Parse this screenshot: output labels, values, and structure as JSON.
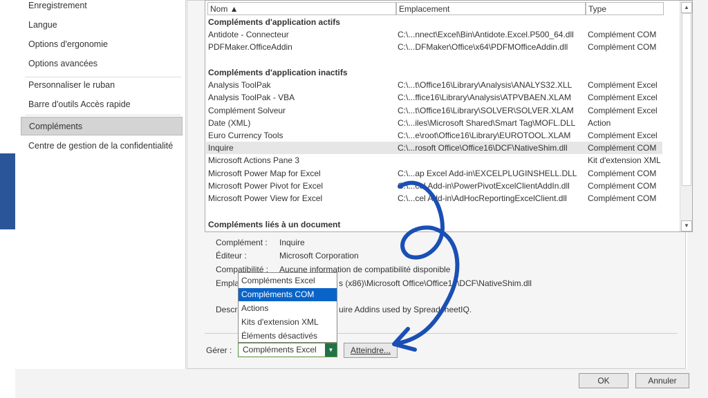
{
  "nav": {
    "items": [
      {
        "label": "Enregistrement"
      },
      {
        "label": "Langue"
      },
      {
        "label": "Options d'ergonomie"
      },
      {
        "label": "Options avancées"
      },
      {
        "label": "Personnaliser le ruban"
      },
      {
        "label": "Barre d'outils Accès rapide"
      },
      {
        "label": "Compléments"
      },
      {
        "label": "Centre de gestion de la confidentialité"
      }
    ]
  },
  "list": {
    "headers": {
      "name": "Nom ▲",
      "location": "Emplacement",
      "type": "Type"
    },
    "groups": {
      "active": "Compléments d'application actifs",
      "inactive": "Compléments d'application inactifs",
      "document": "Compléments liés à un document"
    },
    "active_rows": [
      {
        "name": "Antidote - Connecteur",
        "location": "C:\\...nnect\\Excel\\Bin\\Antidote.Excel.P500_64.dll",
        "type": "Complément COM"
      },
      {
        "name": "PDFMaker.OfficeAddin",
        "location": "C:\\...DFMaker\\Office\\x64\\PDFMOfficeAddin.dll",
        "type": "Complément COM"
      }
    ],
    "inactive_rows": [
      {
        "name": "Analysis ToolPak",
        "location": "C:\\...t\\Office16\\Library\\Analysis\\ANALYS32.XLL",
        "type": "Complément Excel"
      },
      {
        "name": "Analysis ToolPak - VBA",
        "location": "C:\\...ffice16\\Library\\Analysis\\ATPVBAEN.XLAM",
        "type": "Complément Excel"
      },
      {
        "name": "Complément Solveur",
        "location": "C:\\...t\\Office16\\Library\\SOLVER\\SOLVER.XLAM",
        "type": "Complément Excel"
      },
      {
        "name": "Date (XML)",
        "location": "C:\\...iles\\Microsoft Shared\\Smart Tag\\MOFL.DLL",
        "type": "Action"
      },
      {
        "name": "Euro Currency Tools",
        "location": "C:\\...e\\root\\Office16\\Library\\EUROTOOL.XLAM",
        "type": "Complément Excel"
      },
      {
        "name": "Inquire",
        "location": "C:\\...rosoft Office\\Office16\\DCF\\NativeShim.dll",
        "type": "Complément COM"
      },
      {
        "name": "Microsoft Actions Pane 3",
        "location": "",
        "type": "Kit d'extension XML"
      },
      {
        "name": "Microsoft Power Map for Excel",
        "location": "C:\\...ap Excel Add-in\\EXCELPLUGINSHELL.DLL",
        "type": "Complément COM"
      },
      {
        "name": "Microsoft Power Pivot for Excel",
        "location": "C:\\...cel Add-in\\PowerPivotExcelClientAddIn.dll",
        "type": "Complément COM"
      },
      {
        "name": "Microsoft Power View for Excel",
        "location": "C:\\...cel Add-in\\AdHocReportingExcelClient.dll",
        "type": "Complément COM"
      }
    ]
  },
  "details": {
    "addin_label": "Complément :",
    "addin_value": "Inquire",
    "publisher_label": "Éditeur :",
    "publisher_value": "Microsoft Corporation",
    "compat_label": "Compatibilité :",
    "compat_value": "Aucune information de compatibilité disponible",
    "location_label": "Empla",
    "location_value": "s (x86)\\Microsoft Office\\Office16\\DCF\\NativeShim.dll",
    "desc_label": "Descr",
    "desc_value": "uire Addins used by SpreadsheetIQ."
  },
  "manage": {
    "label": "Gérer :",
    "selected": "Compléments Excel",
    "go_button": "Atteindre...",
    "options": [
      "Compléments Excel",
      "Compléments COM",
      "Actions",
      "Kits d'extension XML",
      "Éléments désactivés"
    ]
  },
  "footer": {
    "ok": "OK",
    "cancel": "Annuler"
  },
  "colors": {
    "accent_green": "#217346",
    "selection_blue": "#0a64c8",
    "annotation_blue": "#1a4fb5"
  }
}
